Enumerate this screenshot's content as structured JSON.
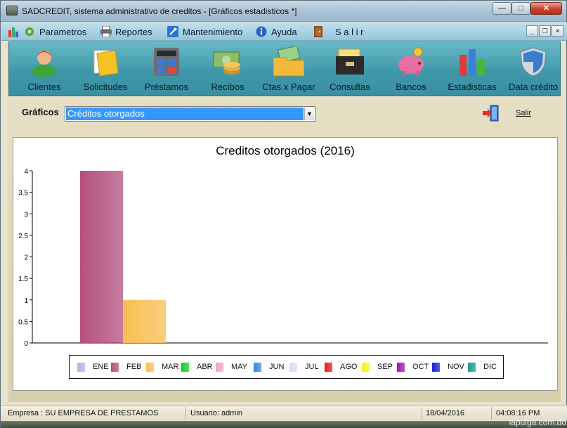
{
  "window": {
    "title": "SADCREDIT, sistema administrativo de creditos - [Gráficos estadisticos *]"
  },
  "menu": {
    "items": [
      {
        "label": "Parametros",
        "icon": "gear-icon"
      },
      {
        "label": "Reportes",
        "icon": "printer-icon"
      },
      {
        "label": "Mantenimiento",
        "icon": "wrench-icon"
      },
      {
        "label": "Ayuda",
        "icon": "info-icon"
      },
      {
        "label": "S a l i r",
        "icon": "door-icon"
      }
    ]
  },
  "toolbar": {
    "buttons": [
      {
        "label": "Clientes",
        "icon": "person-icon"
      },
      {
        "label": "Solicitudes",
        "icon": "folder-icon"
      },
      {
        "label": "Préstamos",
        "icon": "calculator-icon"
      },
      {
        "label": "Recibos",
        "icon": "money-coins-icon"
      },
      {
        "label": "Ctas.x Pagar",
        "icon": "bills-folder-icon"
      },
      {
        "label": "Consultas",
        "icon": "card-file-icon"
      },
      {
        "label": "Bancos",
        "icon": "piggy-bank-icon"
      },
      {
        "label": "Estadisticas",
        "icon": "bar-chart-icon"
      },
      {
        "label": "Data crédito",
        "icon": "shield-icon"
      }
    ]
  },
  "graficos": {
    "label": "Gráficos",
    "selected": "Créditos otorgados",
    "salir_label": "Salir"
  },
  "chart_data": {
    "type": "bar",
    "title": "Creditos otorgados  (2016)",
    "ylim": [
      0,
      4
    ],
    "yticks": [
      "0",
      "0.5",
      "1",
      "1.5",
      "2",
      "2.5",
      "3",
      "3.5",
      "4"
    ],
    "grid": false,
    "legend_position": "bottom",
    "categories": [
      "ENE",
      "FEB",
      "MAR",
      "ABR",
      "MAY",
      "JUN",
      "JUL",
      "AGO",
      "SEP",
      "OCT",
      "NOV",
      "DIC"
    ],
    "values": [
      0,
      4,
      1,
      0,
      0,
      0,
      0,
      0,
      0,
      0,
      0,
      0
    ],
    "colors": [
      "#b6b0e8",
      "#b3507f",
      "#f7bf52",
      "#19cc22",
      "#f3a4b3",
      "#3b82e6",
      "#d7dcf4",
      "#e81c1c",
      "#f7f20f",
      "#9a18a6",
      "#1b1ed8",
      "#1a9a8c"
    ]
  },
  "status": {
    "empresa": "Empresa : SU EMPRESA DE PRESTAMOS",
    "usuario": "Usuario: admin",
    "fecha": "18/04/2016",
    "hora": "04:08:16 PM"
  },
  "watermark": "lapulga.com.do"
}
